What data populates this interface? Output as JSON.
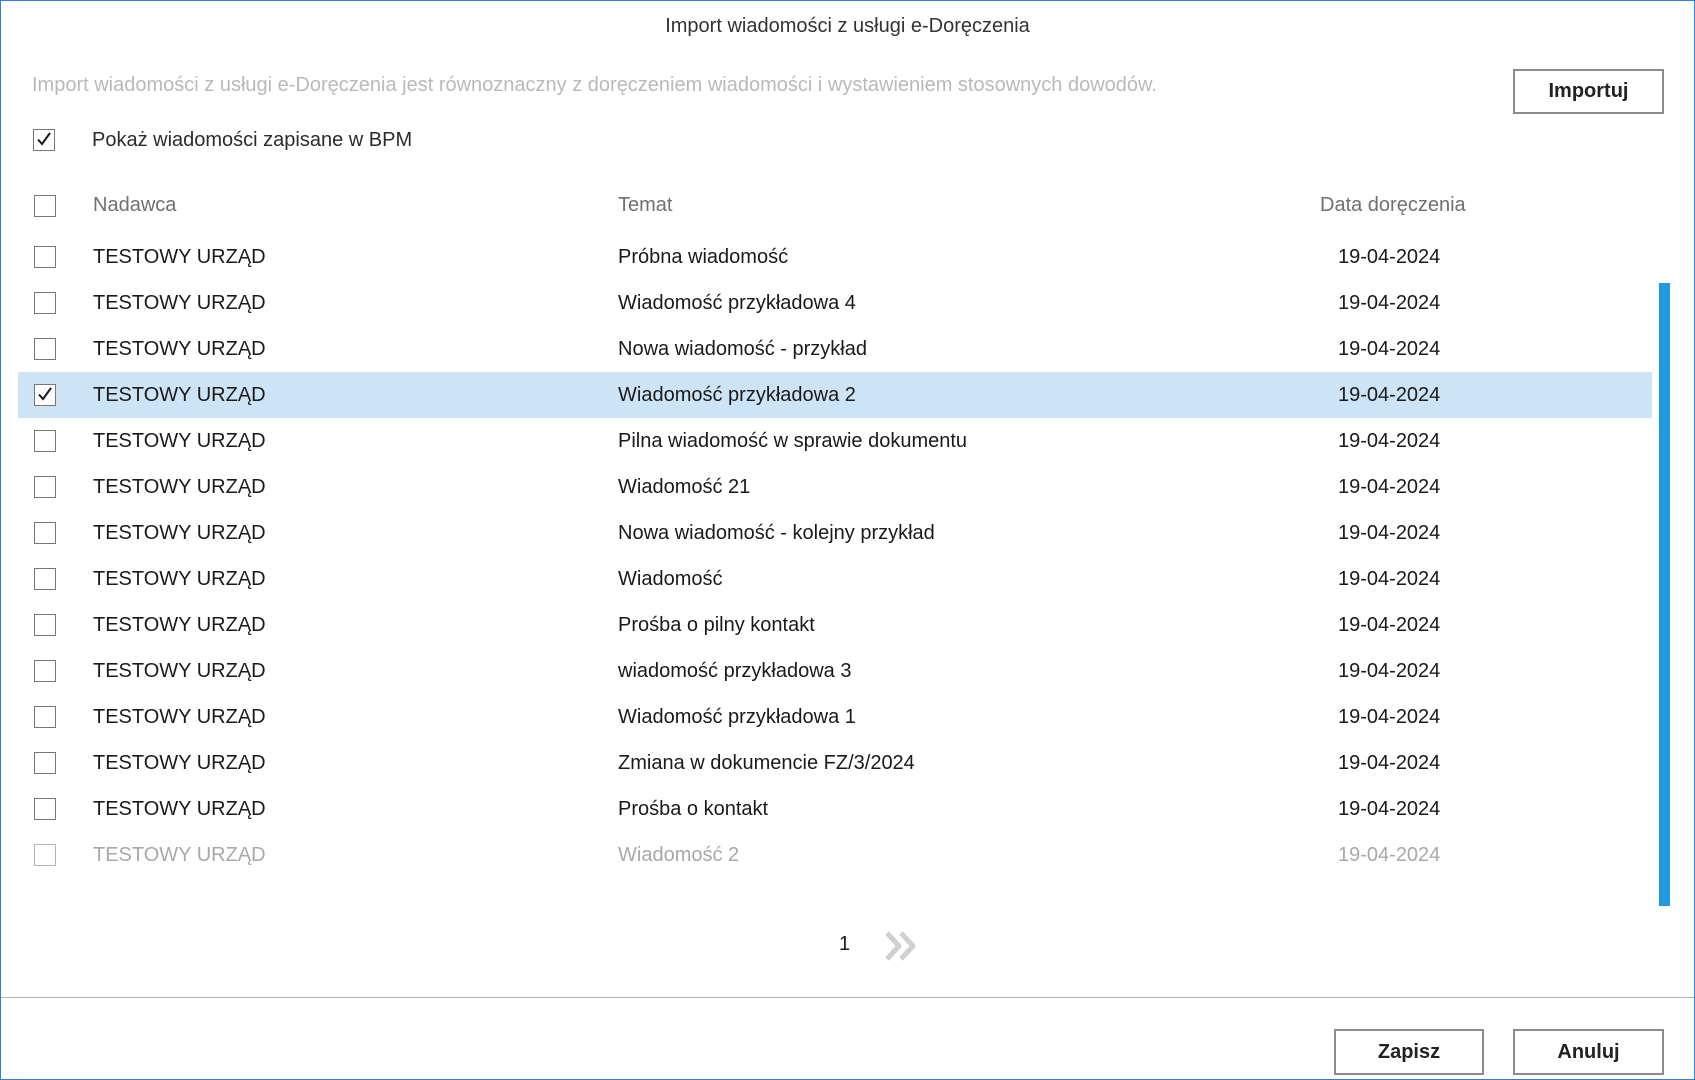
{
  "window": {
    "title": "Import wiadomości z usługi e-Doręczenia",
    "accent_color": "#2d7fd8"
  },
  "info": {
    "text": "Import wiadomości z usługi e-Doręczenia jest równoznaczny z doręczeniem wiadomości i wystawieniem stosownych dowodów."
  },
  "import_button": {
    "label": "Importuj"
  },
  "show_saved": {
    "label": "Pokaż wiadomości zapisane w BPM",
    "checked": true
  },
  "table": {
    "columns": [
      "Nadawca",
      "Temat",
      "Data doręczenia"
    ],
    "select_all_checked": false,
    "selected_row_color": "#cce4f6",
    "rows": [
      {
        "sender": "TESTOWY URZĄD",
        "subject": "Próbna wiadomość",
        "date": "19-04-2024",
        "checked": false
      },
      {
        "sender": "TESTOWY URZĄD",
        "subject": "Wiadomość przykładowa 4",
        "date": "19-04-2024",
        "checked": false
      },
      {
        "sender": "TESTOWY URZĄD",
        "subject": "Nowa wiadomość - przykład",
        "date": "19-04-2024",
        "checked": false
      },
      {
        "sender": "TESTOWY URZĄD",
        "subject": "Wiadomość przykładowa 2",
        "date": "19-04-2024",
        "checked": true
      },
      {
        "sender": "TESTOWY URZĄD",
        "subject": "Pilna wiadomość w sprawie dokumentu",
        "date": "19-04-2024",
        "checked": false
      },
      {
        "sender": "TESTOWY URZĄD",
        "subject": "Wiadomość 21",
        "date": "19-04-2024",
        "checked": false
      },
      {
        "sender": "TESTOWY URZĄD",
        "subject": "Nowa wiadomość - kolejny przykład",
        "date": "19-04-2024",
        "checked": false
      },
      {
        "sender": "TESTOWY URZĄD",
        "subject": "Wiadomość",
        "date": "19-04-2024",
        "checked": false
      },
      {
        "sender": "TESTOWY URZĄD",
        "subject": "Prośba o pilny kontakt",
        "date": "19-04-2024",
        "checked": false
      },
      {
        "sender": "TESTOWY URZĄD",
        "subject": "wiadomość przykładowa 3",
        "date": "19-04-2024",
        "checked": false
      },
      {
        "sender": "TESTOWY URZĄD",
        "subject": "Wiadomość przykładowa 1",
        "date": "19-04-2024",
        "checked": false
      },
      {
        "sender": "TESTOWY URZĄD",
        "subject": "Zmiana w dokumencie FZ/3/2024",
        "date": "19-04-2024",
        "checked": false
      },
      {
        "sender": "TESTOWY URZĄD",
        "subject": "Prośba o kontakt",
        "date": "19-04-2024",
        "checked": false
      },
      {
        "sender": "TESTOWY URZĄD",
        "subject": "Wiadomość 2",
        "date": "19-04-2024",
        "checked": false,
        "faded": true
      }
    ]
  },
  "scrollbar": {
    "color": "#1f9ae0"
  },
  "pager": {
    "page": "1",
    "next_icon": "double-chevron-right-icon"
  },
  "footer": {
    "save_label": "Zapisz",
    "cancel_label": "Anuluj"
  }
}
